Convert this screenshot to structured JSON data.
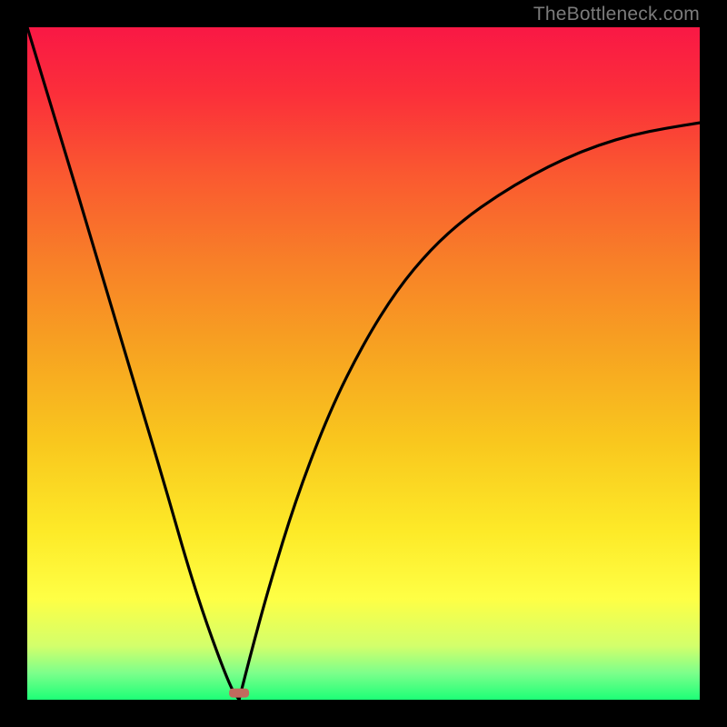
{
  "watermark": "TheBottleneck.com",
  "chart_data": {
    "type": "line",
    "title": "",
    "xlabel": "",
    "ylabel": "",
    "xlim": [
      0,
      1
    ],
    "ylim": [
      0,
      1
    ],
    "grid": false,
    "legend": false,
    "annotations": [
      {
        "text": "TheBottleneck.com",
        "position": "top-right",
        "color": "#7b7b7b"
      }
    ],
    "marker": {
      "x": 0.315,
      "y": 0.01,
      "color": "#c16a5e",
      "shape": "rounded-rect"
    },
    "series": [
      {
        "name": "left-branch",
        "color": "#000000",
        "x": [
          0.0,
          0.05,
          0.1,
          0.15,
          0.2,
          0.25,
          0.3,
          0.315
        ],
        "y": [
          1.0,
          0.835,
          0.67,
          0.5,
          0.335,
          0.16,
          0.022,
          0.0
        ]
      },
      {
        "name": "right-branch",
        "color": "#000000",
        "x": [
          0.315,
          0.33,
          0.36,
          0.4,
          0.45,
          0.5,
          0.55,
          0.6,
          0.65,
          0.7,
          0.75,
          0.8,
          0.85,
          0.9,
          0.95,
          1.0
        ],
        "y": [
          0.0,
          0.06,
          0.17,
          0.3,
          0.43,
          0.53,
          0.61,
          0.67,
          0.715,
          0.75,
          0.78,
          0.805,
          0.825,
          0.84,
          0.85,
          0.858
        ]
      }
    ],
    "background_gradient": {
      "orientation": "vertical",
      "stops": [
        {
          "pos": 0.0,
          "color": "#f91845"
        },
        {
          "pos": 0.35,
          "color": "#f88028"
        },
        {
          "pos": 0.62,
          "color": "#f9c81e"
        },
        {
          "pos": 0.85,
          "color": "#feff45"
        },
        {
          "pos": 1.0,
          "color": "#1dff77"
        }
      ]
    }
  }
}
